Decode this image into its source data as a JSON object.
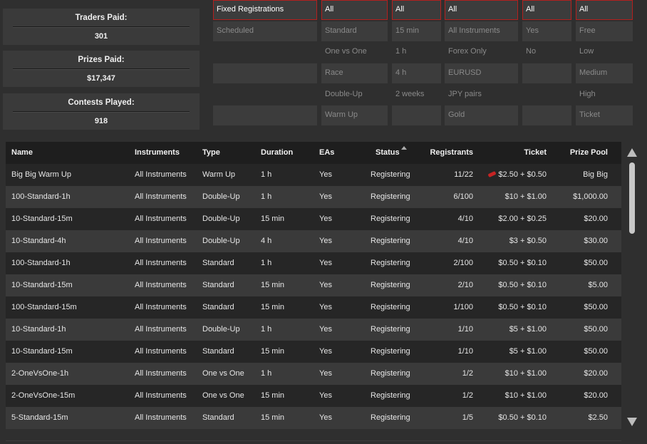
{
  "stats": [
    {
      "label": "Traders Paid:",
      "value": "301"
    },
    {
      "label": "Prizes Paid:",
      "value": "$17,347"
    },
    {
      "label": "Contests Played:",
      "value": "918"
    }
  ],
  "filters": [
    {
      "items": [
        "Fixed Registrations",
        "Scheduled",
        "",
        "",
        "",
        ""
      ]
    },
    {
      "items": [
        "All",
        "Standard",
        "One vs One",
        "Race",
        "Double-Up",
        "Warm Up"
      ]
    },
    {
      "items": [
        "All",
        "15 min",
        "1 h",
        "4 h",
        "2 weeks",
        ""
      ]
    },
    {
      "items": [
        "All",
        "All Instruments",
        "Forex Only",
        "EURUSD",
        "JPY pairs",
        "Gold"
      ]
    },
    {
      "items": [
        "All",
        "Yes",
        "No",
        "",
        "",
        ""
      ]
    },
    {
      "items": [
        "All",
        "Free",
        "Low",
        "Medium",
        "High",
        "Ticket"
      ]
    }
  ],
  "table": {
    "headers": [
      "Name",
      "Instruments",
      "Type",
      "Duration",
      "EAs",
      "Status",
      "Registrants",
      "Ticket",
      "Prize Pool"
    ],
    "rows": [
      [
        "Big Big Warm Up",
        "All Instruments",
        "Warm Up",
        "1 h",
        "Yes",
        "Registering",
        "11/22",
        "$2.50 + $0.50",
        "Big Big"
      ],
      [
        "100-Standard-1h",
        "All Instruments",
        "Double-Up",
        "1 h",
        "Yes",
        "Registering",
        "6/100",
        "$10 + $1.00",
        "$1,000.00"
      ],
      [
        "10-Standard-15m",
        "All Instruments",
        "Double-Up",
        "15 min",
        "Yes",
        "Registering",
        "4/10",
        "$2.00 + $0.25",
        "$20.00"
      ],
      [
        "10-Standard-4h",
        "All Instruments",
        "Double-Up",
        "4 h",
        "Yes",
        "Registering",
        "4/10",
        "$3 + $0.50",
        "$30.00"
      ],
      [
        "100-Standard-1h",
        "All Instruments",
        "Standard",
        "1 h",
        "Yes",
        "Registering",
        "2/100",
        "$0.50 + $0.10",
        "$50.00"
      ],
      [
        "10-Standard-15m",
        "All Instruments",
        "Standard",
        "15 min",
        "Yes",
        "Registering",
        "2/10",
        "$0.50 + $0.10",
        "$5.00"
      ],
      [
        "100-Standard-15m",
        "All Instruments",
        "Standard",
        "15 min",
        "Yes",
        "Registering",
        "1/100",
        "$0.50 + $0.10",
        "$50.00"
      ],
      [
        "10-Standard-1h",
        "All Instruments",
        "Double-Up",
        "1 h",
        "Yes",
        "Registering",
        "1/10",
        "$5 + $1.00",
        "$50.00"
      ],
      [
        "10-Standard-15m",
        "All Instruments",
        "Standard",
        "15 min",
        "Yes",
        "Registering",
        "1/10",
        "$5 + $1.00",
        "$50.00"
      ],
      [
        "2-OneVsOne-1h",
        "All Instruments",
        "One vs One",
        "1 h",
        "Yes",
        "Registering",
        "1/2",
        "$10 + $1.00",
        "$20.00"
      ],
      [
        "2-OneVsOne-15m",
        "All Instruments",
        "One vs One",
        "15 min",
        "Yes",
        "Registering",
        "1/2",
        "$10 + $1.00",
        "$20.00"
      ],
      [
        "5-Standard-15m",
        "All Instruments",
        "Standard",
        "15 min",
        "Yes",
        "Registering",
        "1/5",
        "$0.50 + $0.10",
        "$2.50"
      ]
    ]
  },
  "icons": {
    "sort": "sort-ascending-icon",
    "ticket": "ticket-icon",
    "scroll_up": "arrow-up-icon",
    "scroll_down": "arrow-down-icon"
  },
  "colors": {
    "accent": "#b3201e",
    "background": "#2f2f2f",
    "header": "#1e1e1e"
  }
}
